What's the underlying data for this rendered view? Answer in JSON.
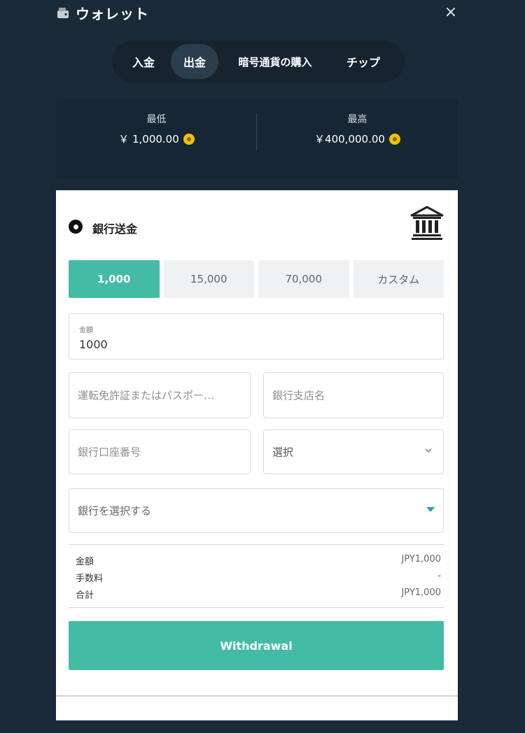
{
  "header": {
    "title": "ウォレット",
    "close_label": "×"
  },
  "tabs": [
    {
      "label": "入金"
    },
    {
      "label": "出金",
      "active": true
    },
    {
      "label": "暗号通貨の購入"
    },
    {
      "label": "チップ"
    }
  ],
  "limits": {
    "min_label": "最低",
    "min_value": "￥ 1,000.00",
    "max_label": "最高",
    "max_value": "￥400,000.00"
  },
  "method": {
    "label": "銀行送金",
    "icon": "bank-icon"
  },
  "presets": [
    {
      "label": "1,000",
      "active": true
    },
    {
      "label": "15,000"
    },
    {
      "label": "70,000"
    },
    {
      "label": "カスタム"
    }
  ],
  "form": {
    "amount_label": "金額",
    "amount_value": "1000",
    "license_placeholder": "運転免許証またはパスポー…",
    "branch_placeholder": "銀行支店名",
    "account_placeholder": "銀行口座番号",
    "select_placeholder": "選択",
    "bank_placeholder": "銀行を選択する"
  },
  "summary": [
    {
      "label": "金額",
      "value": "JPY1,000"
    },
    {
      "label": "手数料",
      "value": "-"
    },
    {
      "label": "合計",
      "value": "JPY1,000"
    }
  ],
  "withdraw_label": "Withdrawal",
  "colors": {
    "background": "#1b2a38",
    "accent": "#44bca5",
    "coin": "#f2c200"
  }
}
